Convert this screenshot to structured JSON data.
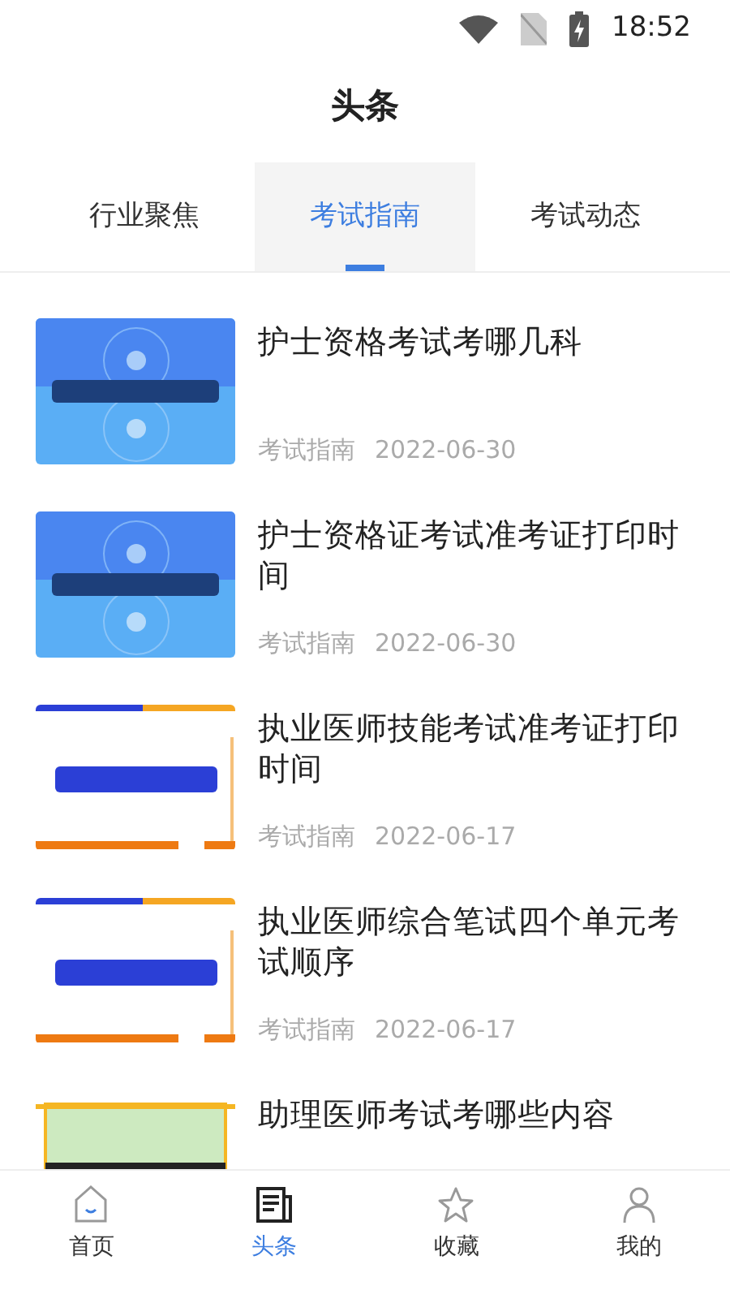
{
  "status_bar": {
    "time": "18:52"
  },
  "header": {
    "title": "头条"
  },
  "tabs": [
    {
      "label": "行业聚焦",
      "selected": false
    },
    {
      "label": "考试指南",
      "selected": true
    },
    {
      "label": "考试动态",
      "selected": false
    }
  ],
  "articles": [
    {
      "title": "护士资格考试考哪几科",
      "category": "考试指南",
      "date": "2022-06-30"
    },
    {
      "title": "护士资格证考试准考证打印时间",
      "category": "考试指南",
      "date": "2022-06-30"
    },
    {
      "title": "执业医师技能考试准考证打印时间",
      "category": "考试指南",
      "date": "2022-06-17"
    },
    {
      "title": "执业医师综合笔试四个单元考试顺序",
      "category": "考试指南",
      "date": "2022-06-17"
    },
    {
      "title": "助理医师考试考哪些内容"
    }
  ],
  "bottom_nav": [
    {
      "label": "首页",
      "kind": "home",
      "selected": false
    },
    {
      "label": "头条",
      "kind": "news",
      "selected": true
    },
    {
      "label": "收藏",
      "kind": "star",
      "selected": false
    },
    {
      "label": "我的",
      "kind": "person",
      "selected": false
    }
  ]
}
